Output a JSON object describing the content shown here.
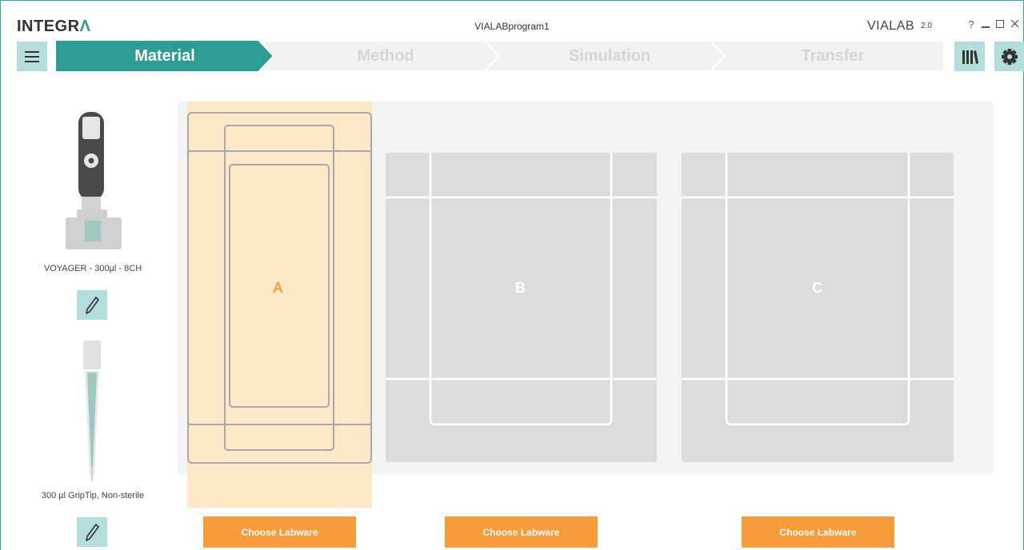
{
  "titlebar": {
    "logo_main": "INTEGR",
    "logo_accent": "Λ",
    "document_title": "VIALABprogram1",
    "app_name": "VIALAB",
    "app_version": "2.0",
    "help_label": "?"
  },
  "nav": {
    "steps": [
      {
        "label": "Material",
        "active": true
      },
      {
        "label": "Method",
        "active": false
      },
      {
        "label": "Simulation",
        "active": false
      },
      {
        "label": "Transfer",
        "active": false
      }
    ]
  },
  "left_panel": {
    "pipette_label": "VOYAGER - 300µl - 8CH",
    "tip_label": "300 µl GripTip, Non-sterile"
  },
  "deck": {
    "positions": [
      {
        "letter": "A",
        "selected": true,
        "button": "Choose Labware"
      },
      {
        "letter": "B",
        "selected": false,
        "button": "Choose Labware"
      },
      {
        "letter": "C",
        "selected": false,
        "button": "Choose Labware"
      }
    ]
  },
  "icons": {
    "menu": "hamburger-icon",
    "library": "library-icon",
    "settings": "gear-icon",
    "edit": "pencil-icon"
  },
  "colors": {
    "accent": "#2d9c95",
    "accent_light": "#b4dedb",
    "orange": "#f79b3b",
    "selected_bg": "#fde9c8",
    "deck_bg": "#f3f3f3",
    "position_bg": "#dcdcdc"
  }
}
